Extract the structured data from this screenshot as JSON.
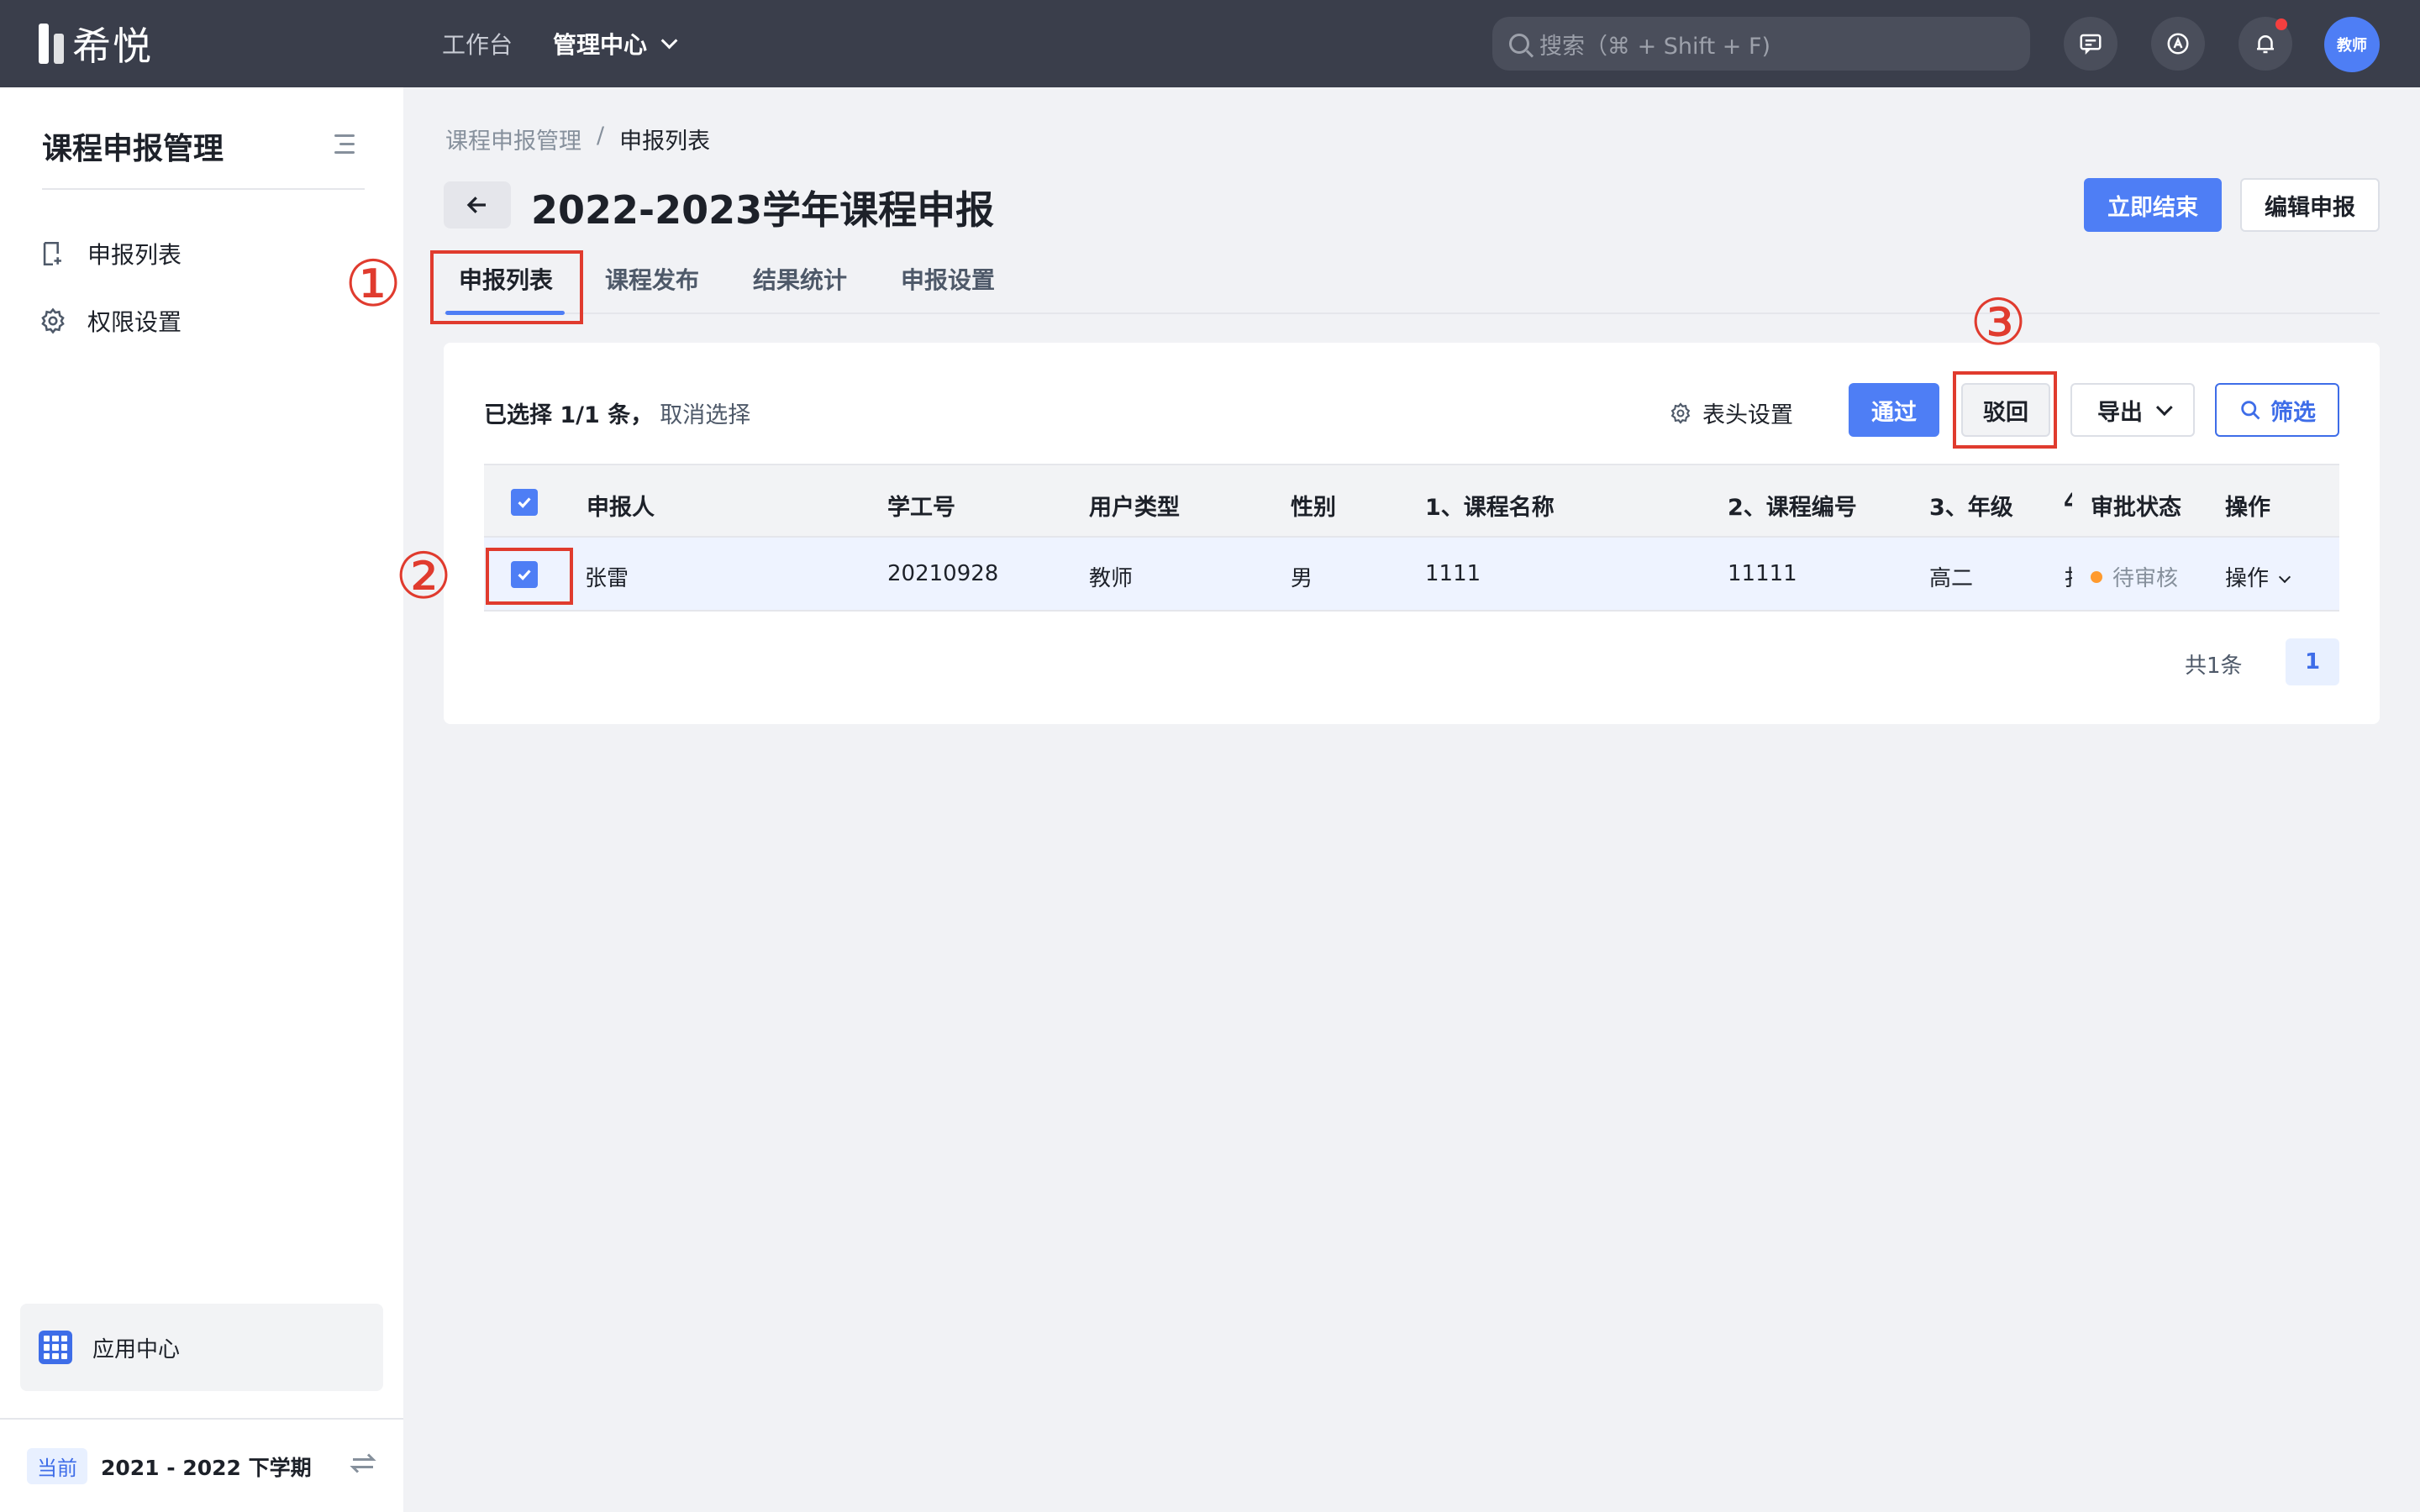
{
  "topbar": {
    "logo_text": "希悦",
    "nav": [
      {
        "label": "工作台",
        "active": false
      },
      {
        "label": "管理中心",
        "active": true
      }
    ],
    "search_placeholder": "搜索（⌘ + Shift + F)",
    "avatar_label": "教师",
    "notification_dot_color": "#f53f3f"
  },
  "sidebar": {
    "title": "课程申报管理",
    "items": [
      {
        "label": "申报列表",
        "icon": "report-list-icon"
      },
      {
        "label": "权限设置",
        "icon": "gear-icon"
      }
    ],
    "app_center": "应用中心",
    "term_badge": "当前",
    "term_text": "2021 - 2022 下学期"
  },
  "main": {
    "breadcrumb": [
      "课程申报管理",
      "/",
      "申报列表"
    ],
    "title": "2022-2023学年课程申报",
    "actions": {
      "end_now": "立即结束",
      "edit": "编辑申报"
    },
    "tabs": [
      {
        "label": "申报列表",
        "active": true
      },
      {
        "label": "课程发布",
        "active": false
      },
      {
        "label": "结果统计",
        "active": false
      },
      {
        "label": "申报设置",
        "active": false
      }
    ],
    "selection": {
      "prefix": "已选择 1/1 条，",
      "cancel": "取消选择"
    },
    "toolbar": {
      "column_setting": "表头设置",
      "approve": "通过",
      "reject": "驳回",
      "export": "导出",
      "filter": "筛选"
    },
    "table": {
      "columns": [
        "申报人",
        "学工号",
        "用户类型",
        "性别",
        "1、课程名称",
        "2、课程编号",
        "3、年级",
        "4",
        "审批状态",
        "操作"
      ],
      "rows": [
        {
          "cells": [
            "张雷",
            "20210928",
            "教师",
            "男",
            "1111",
            "11111",
            "高二",
            "扌",
            "待审核",
            "操作"
          ],
          "checked": true
        }
      ]
    },
    "pagination": {
      "total": "共1条",
      "current": "1"
    }
  },
  "annotations": [
    "①",
    "②",
    "③"
  ],
  "colors": {
    "primary": "#4e7ef5",
    "annotation": "#e03b2e",
    "status_pending": "#ff9a2e"
  }
}
